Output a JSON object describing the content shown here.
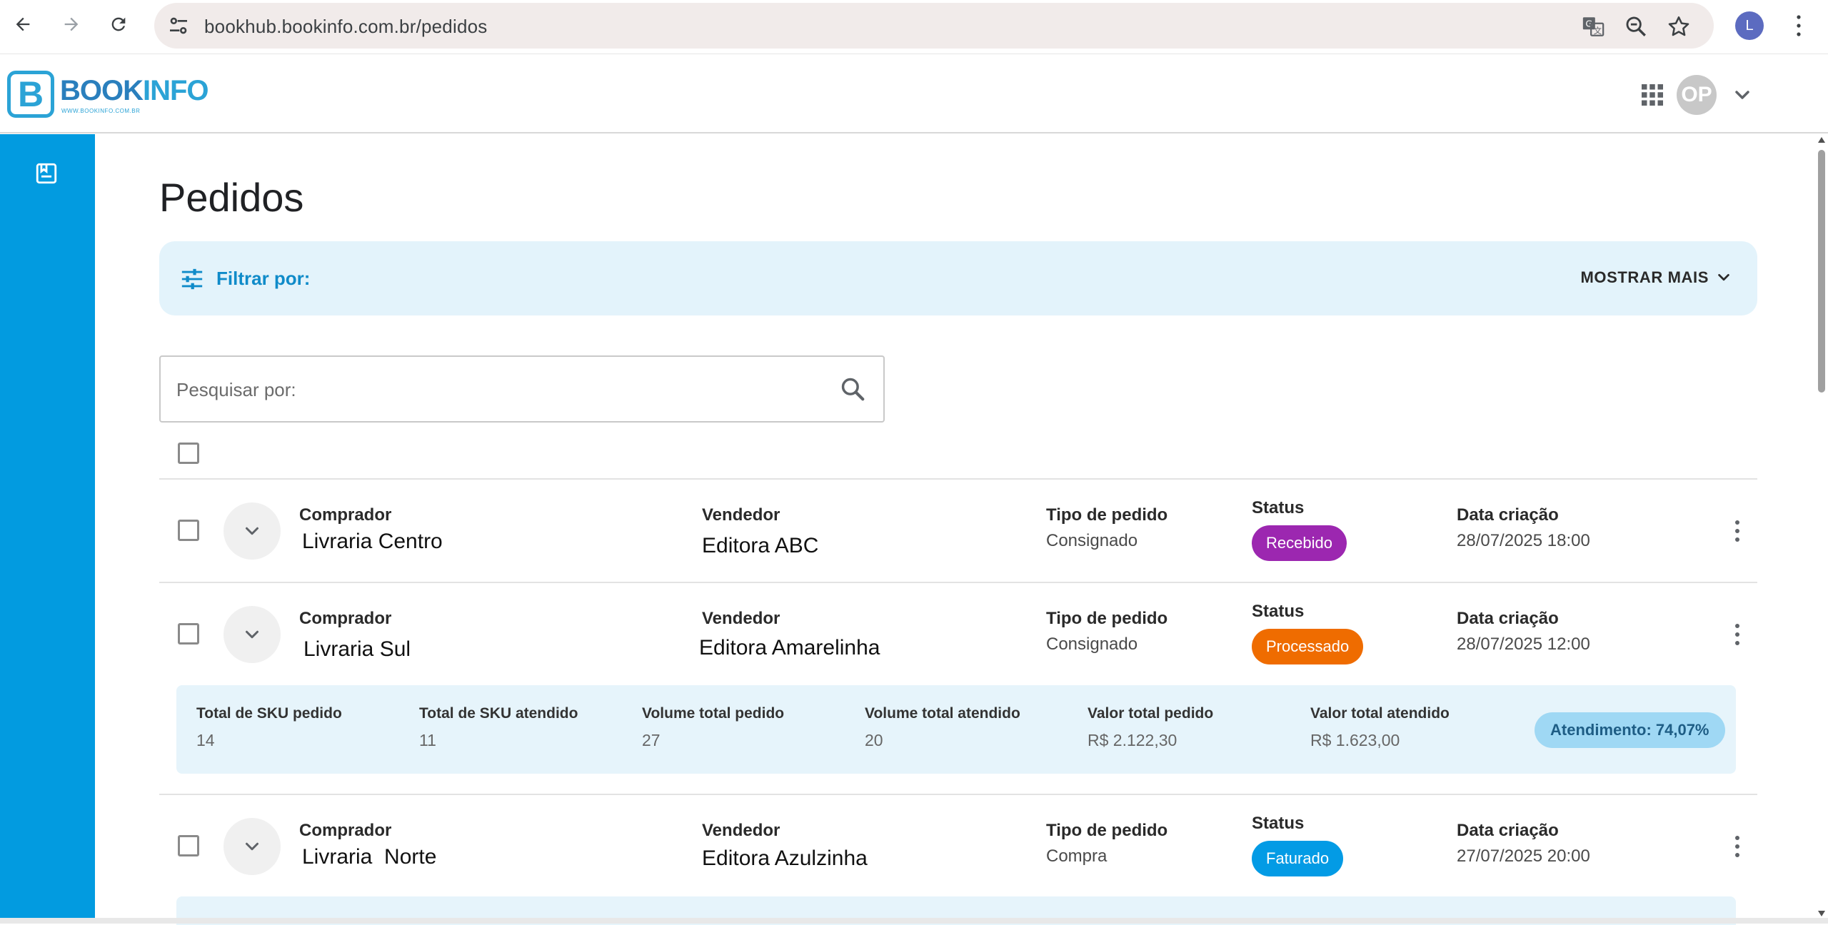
{
  "browser": {
    "url": "bookhub.bookinfo.com.br/pedidos",
    "profile_initial": "L"
  },
  "header": {
    "logo_letter": "B",
    "logo_text_1": "BOOK",
    "logo_text_2": "INFO",
    "logo_sub": "WWW.BOOKINFO.COM.BR",
    "user_initials": "OP"
  },
  "page": {
    "title": "Pedidos"
  },
  "filter": {
    "label": "Filtrar por:",
    "show_more": "MOSTRAR MAIS"
  },
  "search": {
    "placeholder": "Pesquisar por:"
  },
  "labels": {
    "buyer": "Comprador",
    "seller": "Vendedor",
    "order_type": "Tipo de pedido",
    "status": "Status",
    "created": "Data criação"
  },
  "orders": [
    {
      "buyer": "Livraria Centro",
      "seller": "Editora ABC",
      "order_type": "Consignado",
      "status": "Recebido",
      "status_color": "#9c27b0",
      "created": "28/07/2025 18:00"
    },
    {
      "buyer": "Livraria Sul",
      "seller": "Editora Amarelinha",
      "order_type": "Consignado",
      "status": "Processado",
      "status_color": "#ef6c00",
      "created": "28/07/2025 12:00",
      "summary": {
        "sku_ordered_label": "Total de SKU pedido",
        "sku_ordered": "14",
        "sku_fulfilled_label": "Total de SKU atendido",
        "sku_fulfilled": "11",
        "volume_ordered_label": "Volume total pedido",
        "volume_ordered": "27",
        "volume_fulfilled_label": "Volume total atendido",
        "volume_fulfilled": "20",
        "value_ordered_label": "Valor total pedido",
        "value_ordered": "R$ 2.122,30",
        "value_fulfilled_label": "Valor total atendido",
        "value_fulfilled": "R$ 1.623,00",
        "fulfillment": "Atendimento: 74,07%"
      }
    },
    {
      "buyer": "Livraria  Norte",
      "seller": "Editora Azulzinha",
      "order_type": "Compra",
      "status": "Faturado",
      "status_color": "#039be5",
      "created": "27/07/2025 20:00"
    }
  ],
  "colors": {
    "sidebar": "#029be0",
    "accent": "#0f8bc9",
    "filter_bg": "#e3f3fb"
  },
  "icons": {
    "back": "arrow-left-icon",
    "forward": "arrow-right-icon",
    "reload": "reload-icon",
    "site_settings": "tune-icon",
    "translate": "translate-icon",
    "zoom": "zoom-out-icon",
    "bookmark": "star-icon",
    "apps": "apps-grid-icon",
    "sidebar": "orders-icon",
    "filter": "sliders-icon",
    "search": "search-icon"
  }
}
